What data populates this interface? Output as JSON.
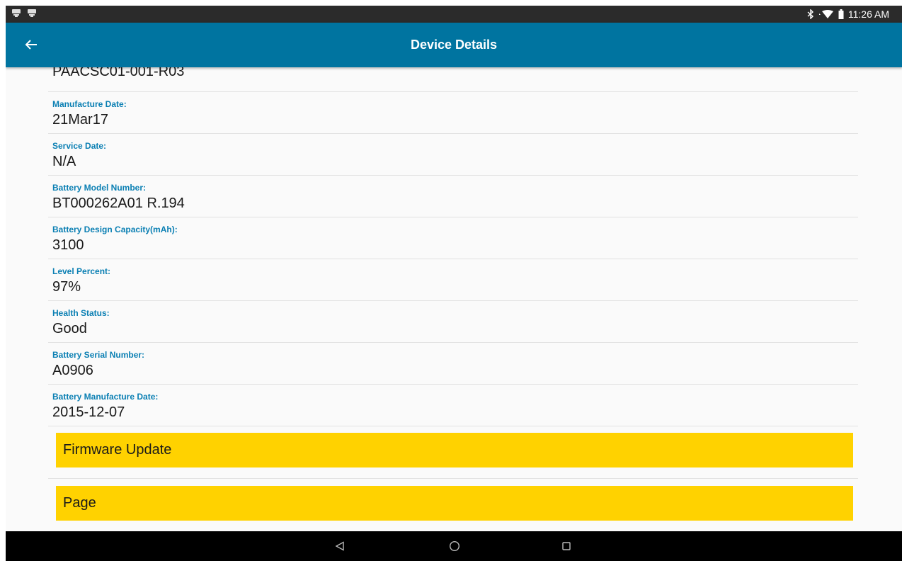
{
  "status_bar": {
    "time": "11:26 AM",
    "left_icons": [
      "notification-icon",
      "notification-icon"
    ],
    "right_icons": [
      "bluetooth-icon",
      "wifi-icon",
      "battery-icon"
    ]
  },
  "app_bar": {
    "title": "Device Details",
    "back_icon": "arrow-left-icon",
    "color": "#0074a0"
  },
  "content": {
    "partial_value": "PAACSC01-001-R03",
    "fields": [
      {
        "label": "Manufacture Date:",
        "value": "21Mar17"
      },
      {
        "label": "Service Date:",
        "value": "N/A"
      },
      {
        "label": "Battery Model Number:",
        "value": "BT000262A01 R.194"
      },
      {
        "label": "Battery Design Capacity(mAh):",
        "value": "3100"
      },
      {
        "label": "Level Percent:",
        "value": "97%"
      },
      {
        "label": "Health Status:",
        "value": "Good"
      },
      {
        "label": "Battery Serial Number:",
        "value": "A0906"
      },
      {
        "label": "Battery Manufacture Date:",
        "value": "2015-12-07"
      }
    ],
    "buttons": [
      {
        "label": "Firmware Update"
      },
      {
        "label": "Page"
      }
    ],
    "label_color": "#0a7fb3",
    "button_color": "#ffd200"
  },
  "nav_bar": {
    "buttons": [
      "back-triangle-icon",
      "home-circle-icon",
      "recents-square-icon"
    ]
  }
}
